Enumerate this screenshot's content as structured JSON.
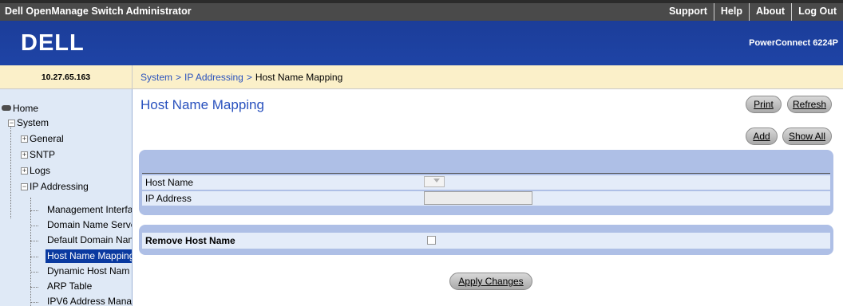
{
  "header": {
    "app_title": "Dell OpenManage Switch Administrator",
    "links": [
      "Support",
      "Help",
      "About",
      "Log Out"
    ],
    "brand": "DELL",
    "product": "PowerConnect 6224P",
    "ip_address": "10.27.65.163"
  },
  "breadcrumb": {
    "items": [
      "System",
      "IP Addressing"
    ],
    "current": "Host Name Mapping",
    "separator": ">"
  },
  "sidebar": {
    "home": "Home",
    "system": "System",
    "general": "General",
    "sntp": "SNTP",
    "logs": "Logs",
    "ip_addressing": "IP Addressing",
    "children": [
      "Management Interfa",
      "Domain Name Serve",
      "Default Domain Nan",
      "Host Name Mapping",
      "Dynamic Host Nam",
      "ARP Table",
      "IPV6 Address Mana"
    ],
    "selected_index": 3
  },
  "main": {
    "title": "Host Name Mapping",
    "print_label": "Print",
    "refresh_label": "Refresh",
    "add_label": "Add",
    "show_all_label": "Show All",
    "host_name_label": "Host Name",
    "ip_address_label": "IP Address",
    "ip_address_value": "",
    "remove_label": "Remove Host Name",
    "remove_checked": false,
    "apply_label": "Apply Changes"
  },
  "colors": {
    "banner": "#1d3f9c",
    "panel": "#aebfe6",
    "row": "#e4ecf9",
    "crumb_bg": "#fbf0c9",
    "link": "#2a52be",
    "selected": "#0a3aa0"
  }
}
